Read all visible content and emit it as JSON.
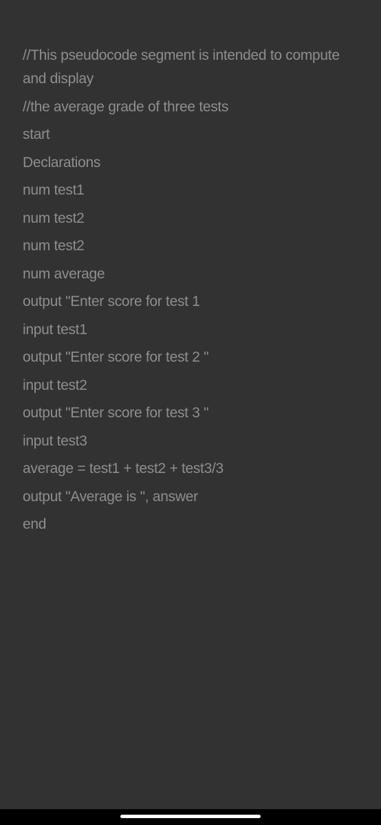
{
  "document": {
    "lines": [
      "//This pseudocode segment is intended to compute and display",
      "//the average grade of three tests",
      "start",
      "Declarations",
      "num test1",
      "num test2",
      "num test2",
      "num average",
      "output \"Enter score for test 1",
      "input test1",
      "output \"Enter score for test 2 \"",
      "input test2",
      "output \"Enter score for test 3 \"",
      "input test3",
      "average = test1 + test2 + test3/3",
      "output \"Average is \", answer",
      "end"
    ]
  },
  "system": {
    "home_indicator": "home-indicator"
  }
}
